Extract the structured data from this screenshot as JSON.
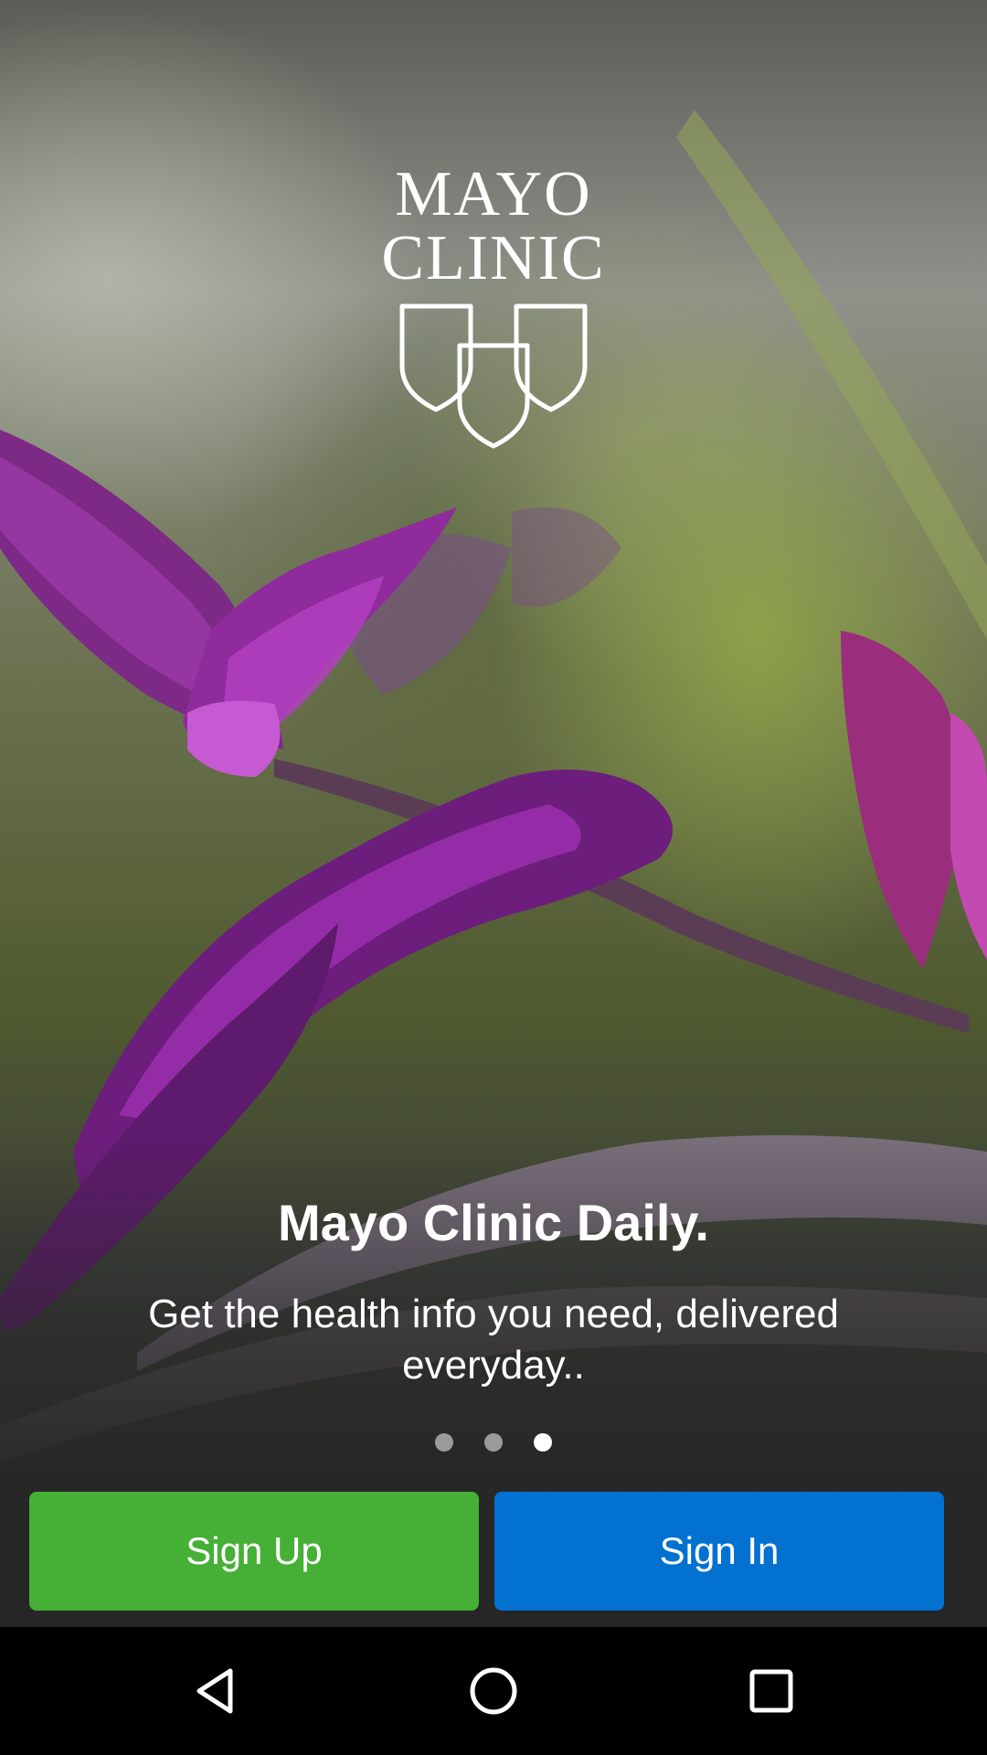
{
  "logo": {
    "line1": "MAYO",
    "line2": "CLINIC"
  },
  "onboarding": {
    "headline": "Mayo Clinic Daily.",
    "subtitle": "Get the health info you need, delivered everyday..",
    "page_indicator": {
      "current": 3,
      "total": 3
    }
  },
  "actions": {
    "signup_label": "Sign Up",
    "signin_label": "Sign In"
  },
  "colors": {
    "signup": "#45b035",
    "signin": "#0271d0",
    "flower": "#8a1f9a"
  },
  "navbar": {
    "icons": [
      "back-triangle",
      "home-circle",
      "recents-square"
    ]
  }
}
